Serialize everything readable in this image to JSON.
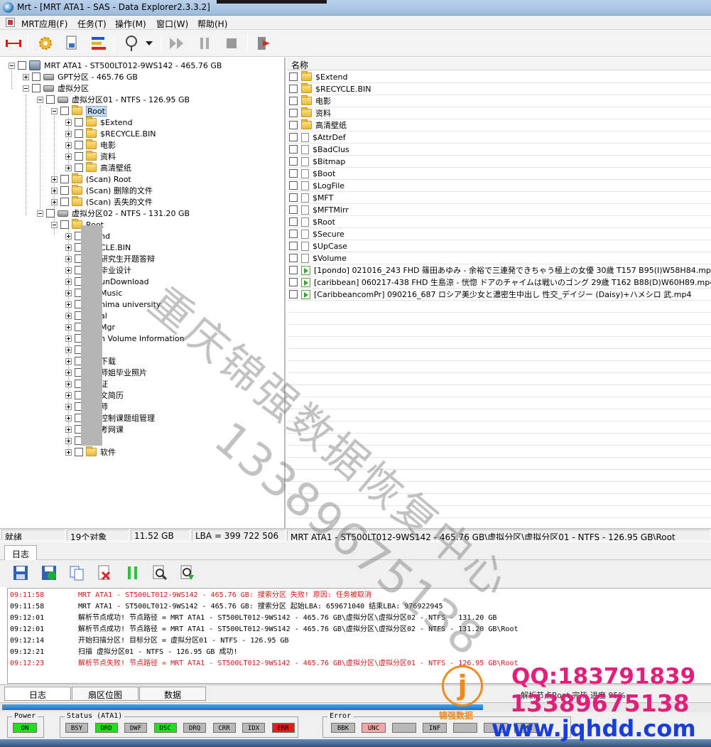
{
  "window": {
    "title": "Mrt - [MRT ATA1 - SAS - Data Explorer2.3.3.2]"
  },
  "menu": [
    "MRT应用(F)",
    "任务(T)",
    "操作(M)",
    "窗口(W)",
    "帮助(H)"
  ],
  "toolbar": {
    "icons": [
      "connect-icon",
      "gear-icon",
      "document-icon",
      "color-bars-icon",
      "wand-icon",
      "dropdown-arrow-icon",
      "play-forward-icon",
      "pause-icon",
      "stop-icon",
      "exit-icon"
    ]
  },
  "tree": {
    "root_label": "MRT ATA1 - ST500LT012-9WS142 - 465.76 GB",
    "gpt_label": "GPT分区 - 465.76 GB",
    "virtual_label": "虚拟分区",
    "vp1_label": "虚拟分区01 - NTFS - 126.95 GB",
    "vp1_root": "Root",
    "vp1_children": [
      "$Extend",
      "$RECYCLE.BIN",
      "电影",
      "资料",
      "高清壁纸"
    ],
    "scan_items": [
      "(Scan) Root",
      "(Scan) 删除的文件",
      "(Scan) 丢失的文件"
    ],
    "vp2_label": "虚拟分区02 - NTFS - 131.20 GB",
    "vp2_root": "Root",
    "vp2_children": [
      "nd",
      "CLE.BIN",
      "研究生开题答辩",
      "毕业设计",
      "unDownload",
      "Music",
      "hima university",
      "al",
      "Mgr",
      "n Volume Information",
      "",
      "下载",
      "师姐毕业照片",
      "证",
      "文简历",
      "师",
      "控制课题组管理",
      "考网课",
      "",
      "软件"
    ]
  },
  "list": {
    "header": "名称",
    "rows": [
      {
        "name": "$Extend",
        "type": "folder"
      },
      {
        "name": "$RECYCLE.BIN",
        "type": "folder"
      },
      {
        "name": "电影",
        "type": "folder"
      },
      {
        "name": "资料",
        "type": "folder"
      },
      {
        "name": "高清壁纸",
        "type": "folder"
      },
      {
        "name": "$AttrDef",
        "type": "file"
      },
      {
        "name": "$BadClus",
        "type": "file"
      },
      {
        "name": "$Bitmap",
        "type": "file"
      },
      {
        "name": "$Boot",
        "type": "file"
      },
      {
        "name": "$LogFile",
        "type": "file"
      },
      {
        "name": "$MFT",
        "type": "file"
      },
      {
        "name": "$MFTMirr",
        "type": "file"
      },
      {
        "name": "$Root",
        "type": "file"
      },
      {
        "name": "$Secure",
        "type": "file"
      },
      {
        "name": "$UpCase",
        "type": "file"
      },
      {
        "name": "$Volume",
        "type": "file"
      },
      {
        "name": "[1pondo] 021016_243 FHD 篠田あゆみ - 余裕で三連発できちゃう極上の女優 30歳 T157 B95(I)W58H84.mp4",
        "type": "video"
      },
      {
        "name": "[caribbean] 060217-438 FHD 生島涼 - 恍惚 ドアのチャイムは戦いのゴング 29歳 T162 B88(D)W60H89.mp4",
        "type": "video"
      },
      {
        "name": "[CaribbeancomPr] 090216_687 ロシア美少女と濃密生中出し 性交_デイジー (Daisy)+ハメシロ 武.mp4",
        "type": "video"
      }
    ]
  },
  "status": {
    "state": "就绪",
    "count": "19个对象",
    "size": "11.52 GB",
    "lba": "LBA = 399 722 506",
    "path": "MRT ATA1 - ST500LT012-9WS142 - 465.76 GB\\虚拟分区\\虚拟分区01 - NTFS - 126.95 GB\\Root"
  },
  "log": {
    "tab": "日志",
    "toolbar_icons": [
      "save-icon",
      "save-green-icon",
      "copy-icon",
      "delete-icon",
      "pause-green-icon",
      "search-icon",
      "export-icon"
    ],
    "lines": [
      {
        "time": "09:11:58",
        "text": "MRT ATA1 - ST500LT012-9WS142 - 465.76 GB: 搜索分区  失败!   原因: 任务被取消",
        "level": "error"
      },
      {
        "time": "09:11:58",
        "text": "MRT ATA1 - ST500LT012-9WS142 - 465.76 GB: 搜索分区  起始LBA: 659671040   结束LBA: 976922945",
        "level": "info"
      },
      {
        "time": "09:12:01",
        "text": "解析节点成功!  节点路径 = MRT ATA1 - ST500LT012-9WS142 - 465.76 GB\\虚拟分区\\虚拟分区02 - NTFS - 131.20 GB",
        "level": "info"
      },
      {
        "time": "09:12:01",
        "text": "解析节点成功!  节点路径 = MRT ATA1 - ST500LT012-9WS142 - 465.76 GB\\虚拟分区\\虚拟分区02 - NTFS - 131.20 GB\\Root",
        "level": "info"
      },
      {
        "time": "09:12:14",
        "text": "开始扫描分区! 目标分区 = 虚拟分区01 - NTFS - 126.95 GB",
        "level": "info"
      },
      {
        "time": "09:12:21",
        "text": "扫描 虚拟分区01 - NTFS - 126.95 GB 成功!",
        "level": "info"
      },
      {
        "time": "09:12:23",
        "text": "解析节点失败!   节点路径 = MRT ATA1 - ST500LT012-9WS142 - 465.76 GB\\虚拟分区\\虚拟分区01 - NTFS - 126.95 GB\\Root",
        "level": "error"
      }
    ]
  },
  "bottom_tabs": [
    "日志",
    "扇区位图",
    "数据"
  ],
  "bottom_status": "解析节点Root 完毕  进度 95%",
  "progress": 0.68,
  "indicators": {
    "power_label": "Power",
    "power": [
      {
        "label": "ON",
        "state": "green"
      }
    ],
    "status_label": "Status (ATA1)",
    "status": [
      {
        "label": "BSY",
        "state": "off"
      },
      {
        "label": "DRD",
        "state": "green"
      },
      {
        "label": "DWF",
        "state": "off"
      },
      {
        "label": "DSC",
        "state": "green"
      },
      {
        "label": "DRQ",
        "state": "off"
      },
      {
        "label": "CRR",
        "state": "off"
      },
      {
        "label": "IDX",
        "state": "off"
      },
      {
        "label": "ERR",
        "state": "red"
      }
    ],
    "error_label": "Error",
    "error": [
      {
        "label": "BBK",
        "state": "off"
      },
      {
        "label": "UNC",
        "state": "pink"
      },
      {
        "label": "",
        "state": "off"
      },
      {
        "label": "INF",
        "state": "off"
      },
      {
        "label": "",
        "state": "off"
      },
      {
        "label": "",
        "state": "off"
      },
      {
        "label": "AMN",
        "state": "off"
      }
    ]
  },
  "watermark": {
    "main": "重庆锦强数据恢复中心",
    "phone": "13389675138",
    "qq": "QQ:183791839",
    "tel": "13389675138",
    "web": "www.jqhdd.com",
    "logo_text": "锦强数据",
    "logo_glyph": "j"
  },
  "colors": {
    "accent": "#316ac5",
    "error": "#d21818",
    "ok": "#1fe01f",
    "watermark_pink": "#e0207a",
    "watermark_blue": "#1a3fd8"
  }
}
